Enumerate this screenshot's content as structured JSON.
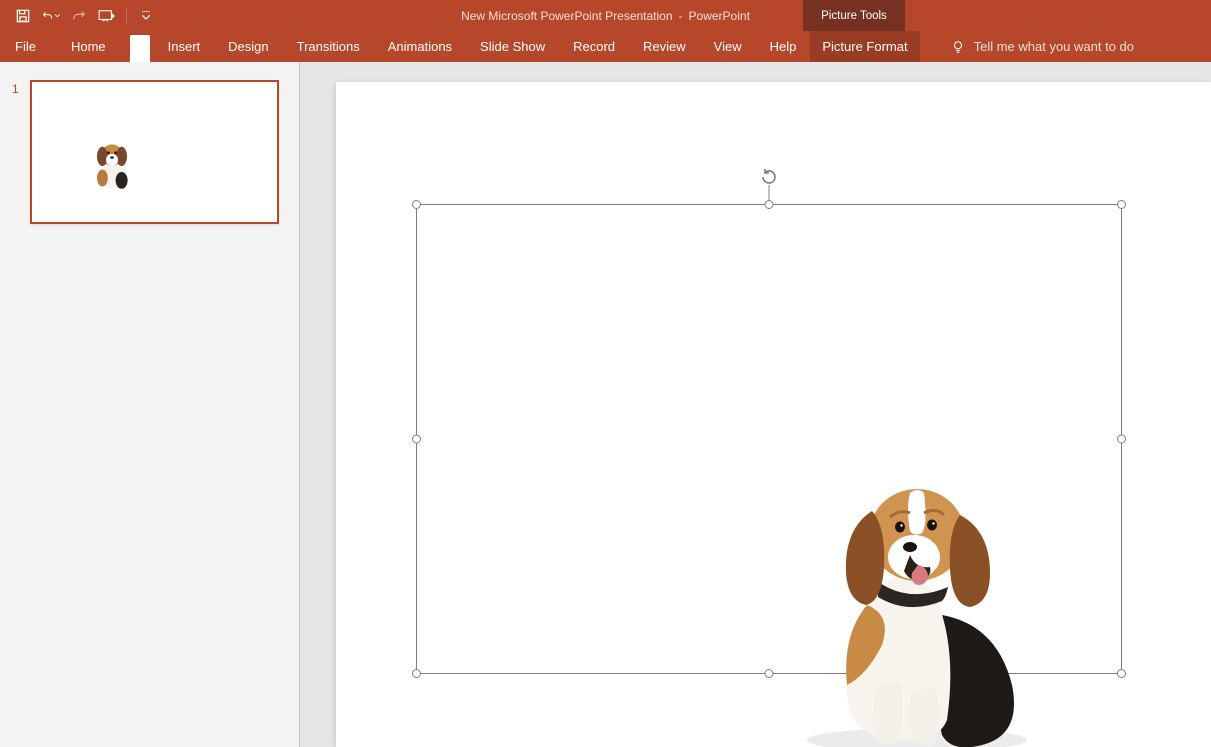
{
  "title": {
    "doc": "New Microsoft PowerPoint Presentation",
    "app": "PowerPoint",
    "context_tab": "Picture Tools"
  },
  "tabs": {
    "file": "File",
    "home": "Home",
    "blank": " ",
    "insert": "Insert",
    "design": "Design",
    "transitions": "Transitions",
    "animations": "Animations",
    "slideshow": "Slide Show",
    "record": "Record",
    "review": "Review",
    "view": "View",
    "help": "Help",
    "picture_format": "Picture Format",
    "tellme": "Tell me what you want to do"
  },
  "thumbs": {
    "slide1_num": "1"
  },
  "icons": {
    "save": "save-icon",
    "undo": "undo-icon",
    "redo": "redo-icon",
    "present": "present-from-start-icon",
    "customize": "customize-qat-icon",
    "bulb": "lightbulb-icon",
    "rotate": "rotate-handle-icon"
  },
  "content": {
    "selected_object": "dog-image"
  }
}
